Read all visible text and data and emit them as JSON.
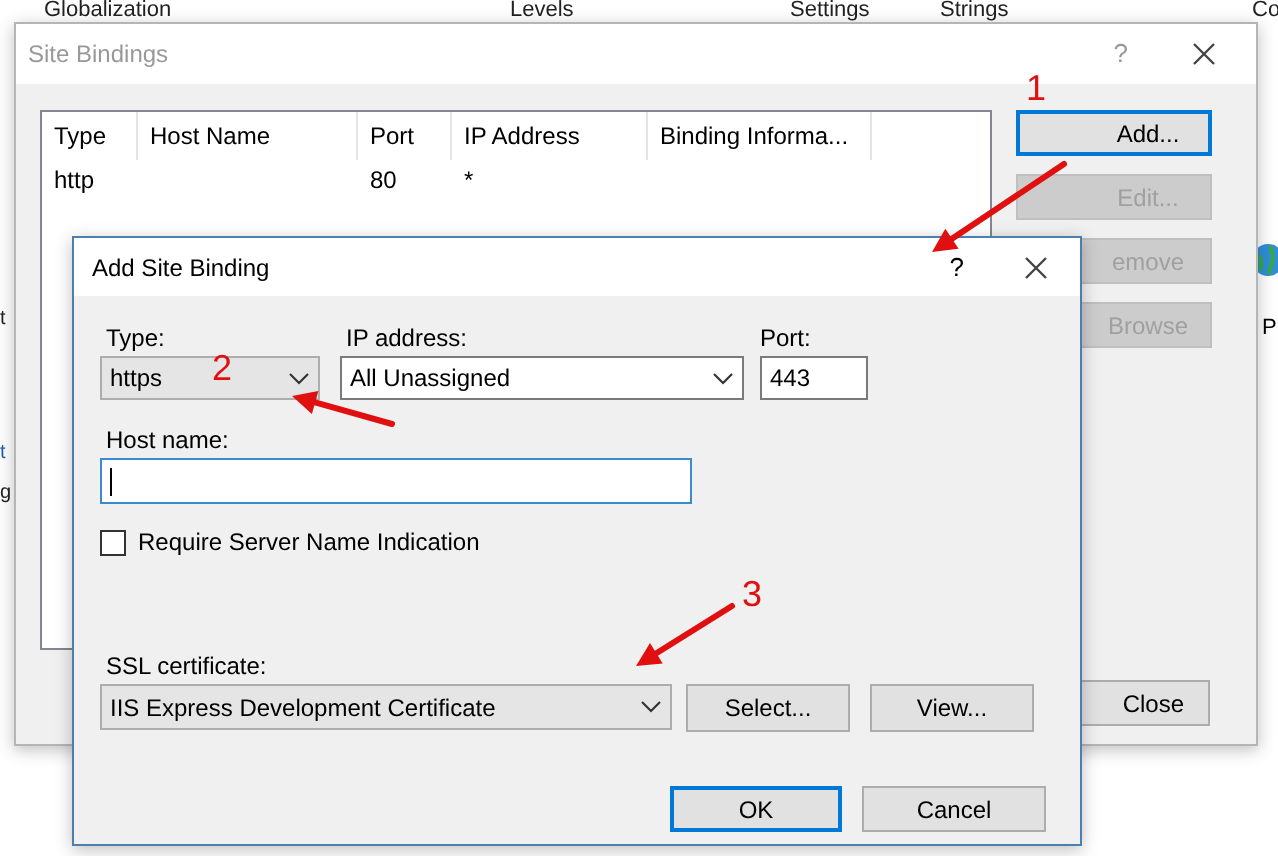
{
  "background": {
    "headers": [
      "Globalization",
      "Levels",
      "Settings",
      "Strings",
      "Co"
    ],
    "left_fragments": [
      "t",
      "t",
      "g"
    ],
    "right_fragment": "P"
  },
  "site_bindings": {
    "title": "Site Bindings",
    "help": "?",
    "columns": [
      "Type",
      "Host Name",
      "Port",
      "IP Address",
      "Binding Informa..."
    ],
    "rows": [
      {
        "type": "http",
        "port": "80",
        "ip_address": "*"
      }
    ],
    "buttons": [
      {
        "label": "Add...",
        "disabled": false,
        "focused": true
      },
      {
        "label": "Edit...",
        "disabled": true,
        "focused": false
      },
      {
        "label": "emove",
        "disabled": true,
        "focused": false
      },
      {
        "label": "Browse",
        "disabled": true,
        "focused": false
      }
    ],
    "close_button": "Close"
  },
  "add_dialog": {
    "title": "Add Site Binding",
    "help": "?",
    "type": {
      "label": "Type:",
      "value": "https"
    },
    "ip_address": {
      "label": "IP address:",
      "value": "All Unassigned"
    },
    "port": {
      "label": "Port:",
      "value": "443"
    },
    "host_name": {
      "label": "Host name:",
      "focused": true
    },
    "sni": {
      "label": "Require Server Name Indication",
      "checked": false
    },
    "ssl_certificate": {
      "label": "SSL certificate:",
      "value": "IIS Express Development Certificate"
    },
    "select_button": "Select...",
    "view_button": "View...",
    "ok_button": {
      "label": "OK",
      "default": true
    },
    "cancel_button": "Cancel"
  },
  "annotations": [
    {
      "text": "1"
    },
    {
      "text": "2"
    },
    {
      "text": "3"
    }
  ]
}
